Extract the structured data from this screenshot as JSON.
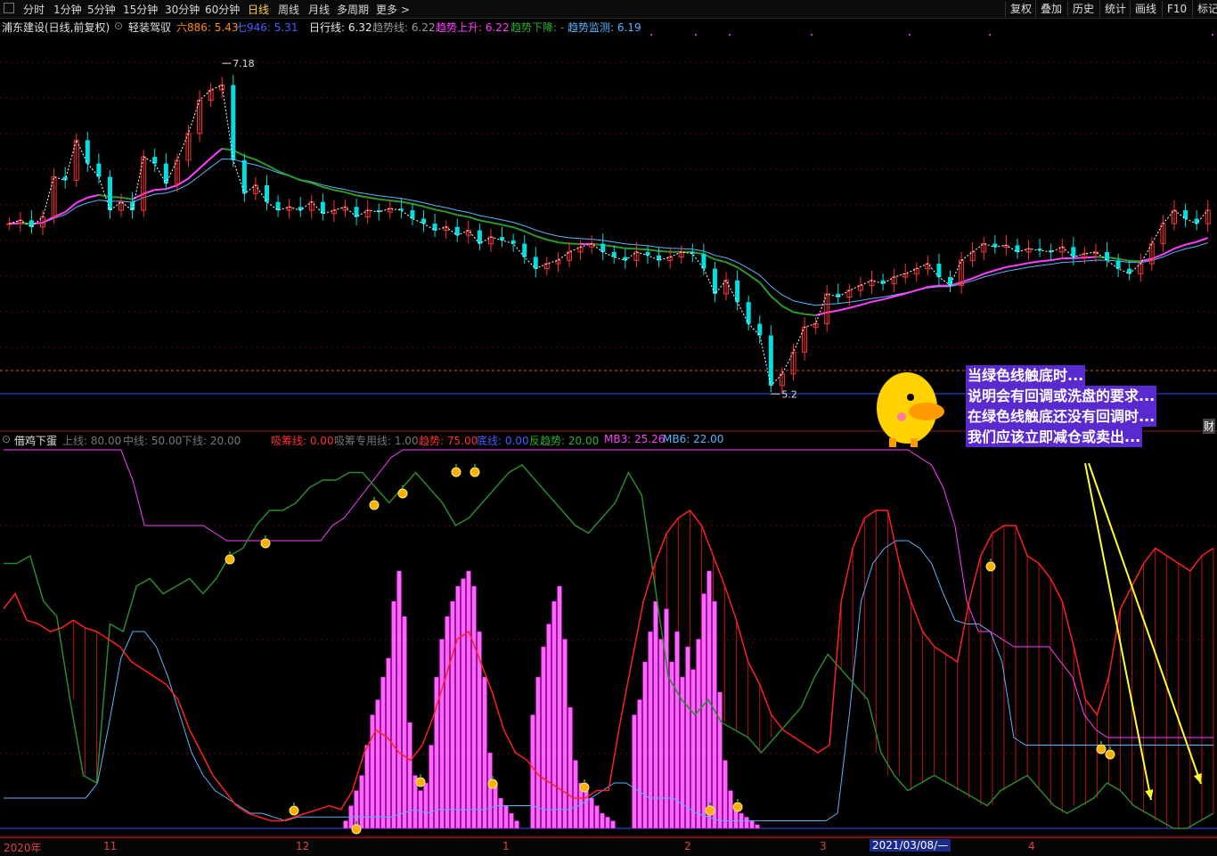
{
  "toolbar": {
    "periods": [
      "分时",
      "1分钟",
      "5分钟",
      "15分钟",
      "30分钟",
      "60分钟",
      "日线",
      "周线",
      "月线",
      "多周期",
      "更多 >"
    ],
    "active": "日线",
    "right_buttons": [
      "复权",
      "叠加",
      "历史",
      "统计",
      "画线",
      "F10",
      "标记"
    ]
  },
  "price_header": {
    "stock": "浦东建设(日线,前复权)",
    "indicator": "轻装驾驭",
    "ma_a_label": "六886: 5.43",
    "ma_b_label": "七946: 5.31",
    "daily_line": "日行线: 6.32",
    "trend_line": "趋势线: 6.22",
    "trend_up": "趋势上升: 6.22",
    "trend_down": "趋势下降: -",
    "trend_monitor": "趋势监测: 6.19",
    "high_label": "7.18",
    "low_label": "5.20"
  },
  "osc_header": {
    "name": "借鸡下蛋",
    "upper": "上线: 80.00",
    "middle": "中线: 50.00",
    "lower": "下线: 20.00",
    "absorb": "吸筹线: 0.00",
    "absorb_special": "吸筹专用线: 1.00",
    "trend": "趋势: 75.00",
    "bottom": "底线: 0.00",
    "counter_trend": "反趋势: 20.00",
    "mb3": "MB3: 25.26",
    "mb6": "MB6: 22.00"
  },
  "annotation": {
    "lines": [
      "当绿色线触底时...",
      "说明会有回调或洗盘的要求...",
      "在绿色线触底还没有回调时...",
      "我们应该立即减仓或卖出..."
    ],
    "side_tag": "财"
  },
  "date_axis": {
    "labels": [
      "2020年",
      "11",
      "12",
      "1",
      "2",
      "3",
      "4"
    ],
    "selected": "2021/03/08/—"
  },
  "colors": {
    "up": "#ff3232",
    "down": "#00e0e0",
    "ma_magenta": "#ff40ff",
    "ma_green": "#2a9a2a",
    "ma_blue": "#5ab4ff",
    "trend_red": "#ff2020",
    "counter_green": "#2a8a2a",
    "absorb_pink": "#ff66ff"
  },
  "chart_data": [
    {
      "type": "candlestick",
      "title": "浦东建设(日线,前复权)",
      "ylim": [
        5.0,
        7.35
      ],
      "annotations": {
        "high": 7.18,
        "low": 5.2
      },
      "close": [
        6.22,
        6.24,
        6.2,
        6.26,
        6.5,
        6.48,
        6.72,
        6.58,
        6.5,
        6.3,
        6.35,
        6.3,
        6.62,
        6.58,
        6.46,
        6.6,
        6.76,
        6.96,
        7.02,
        7.05,
        6.6,
        6.4,
        6.45,
        6.35,
        6.3,
        6.32,
        6.3,
        6.35,
        6.28,
        6.3,
        6.32,
        6.26,
        6.3,
        6.29,
        6.31,
        6.3,
        6.25,
        6.22,
        6.18,
        6.2,
        6.15,
        6.18,
        6.1,
        6.14,
        6.12,
        6.1,
        6.02,
        5.95,
        5.98,
        6.0,
        6.05,
        6.08,
        6.1,
        6.05,
        6.02,
        6.0,
        6.05,
        6.03,
        6.0,
        6.02,
        6.05,
        6.04,
        5.95,
        5.8,
        5.88,
        5.75,
        5.62,
        5.55,
        5.25,
        5.32,
        5.45,
        5.6,
        5.62,
        5.8,
        5.78,
        5.82,
        5.85,
        5.88,
        5.86,
        5.9,
        5.92,
        5.95,
        5.98,
        5.9,
        5.85,
        6.0,
        6.05,
        6.1,
        6.08,
        6.09,
        6.05,
        6.07,
        6.06,
        6.05,
        6.08,
        6.02,
        6.04,
        6.05,
        6.0,
        5.95,
        5.92,
        5.98,
        6.1,
        6.22,
        6.3,
        6.25,
        6.22,
        6.3
      ]
    },
    {
      "type": "line",
      "title": "借鸡下蛋",
      "ylim": [
        0,
        100
      ],
      "series": [
        {
          "name": "趋势",
          "values": [
            58,
            62,
            55,
            54,
            52,
            53,
            55,
            53,
            52,
            50,
            48,
            44,
            42,
            40,
            38,
            34,
            26,
            20,
            14,
            10,
            6,
            4,
            3,
            2,
            2,
            3,
            4,
            5,
            6,
            5,
            10,
            20,
            26,
            24,
            20,
            18,
            22,
            30,
            40,
            50,
            52,
            44,
            36,
            26,
            20,
            18,
            14,
            12,
            10,
            8,
            8,
            10,
            10,
            28,
            44,
            60,
            70,
            78,
            82,
            84,
            80,
            72,
            64,
            55,
            44,
            38,
            30,
            26,
            24,
            22,
            20,
            22,
            60,
            74,
            82,
            84,
            84,
            70,
            60,
            52,
            48,
            46,
            44,
            60,
            72,
            78,
            80,
            80,
            72,
            70,
            66,
            60,
            48,
            34,
            30,
            40,
            58,
            64,
            70,
            74,
            72,
            70,
            68,
            72,
            74
          ]
        },
        {
          "name": "反趋势",
          "values": [
            70,
            70,
            72,
            60,
            56,
            34,
            14,
            12,
            54,
            52,
            64,
            66,
            62,
            64,
            66,
            62,
            66,
            72,
            74,
            80,
            84,
            84,
            86,
            90,
            92,
            92,
            94,
            94,
            90,
            86,
            90,
            94,
            90,
            86,
            80,
            82,
            86,
            90,
            94,
            96,
            92,
            88,
            84,
            80,
            78,
            82,
            86,
            94,
            88,
            64,
            40,
            34,
            30,
            34,
            28,
            26,
            24,
            20,
            24,
            28,
            32,
            40,
            46,
            42,
            38,
            34,
            20,
            14,
            10,
            12,
            14,
            12,
            10,
            8,
            6,
            10,
            12,
            14,
            10,
            6,
            4,
            6,
            8,
            12,
            10,
            6,
            4,
            2,
            0,
            0,
            2,
            4
          ]
        }
      ]
    }
  ]
}
